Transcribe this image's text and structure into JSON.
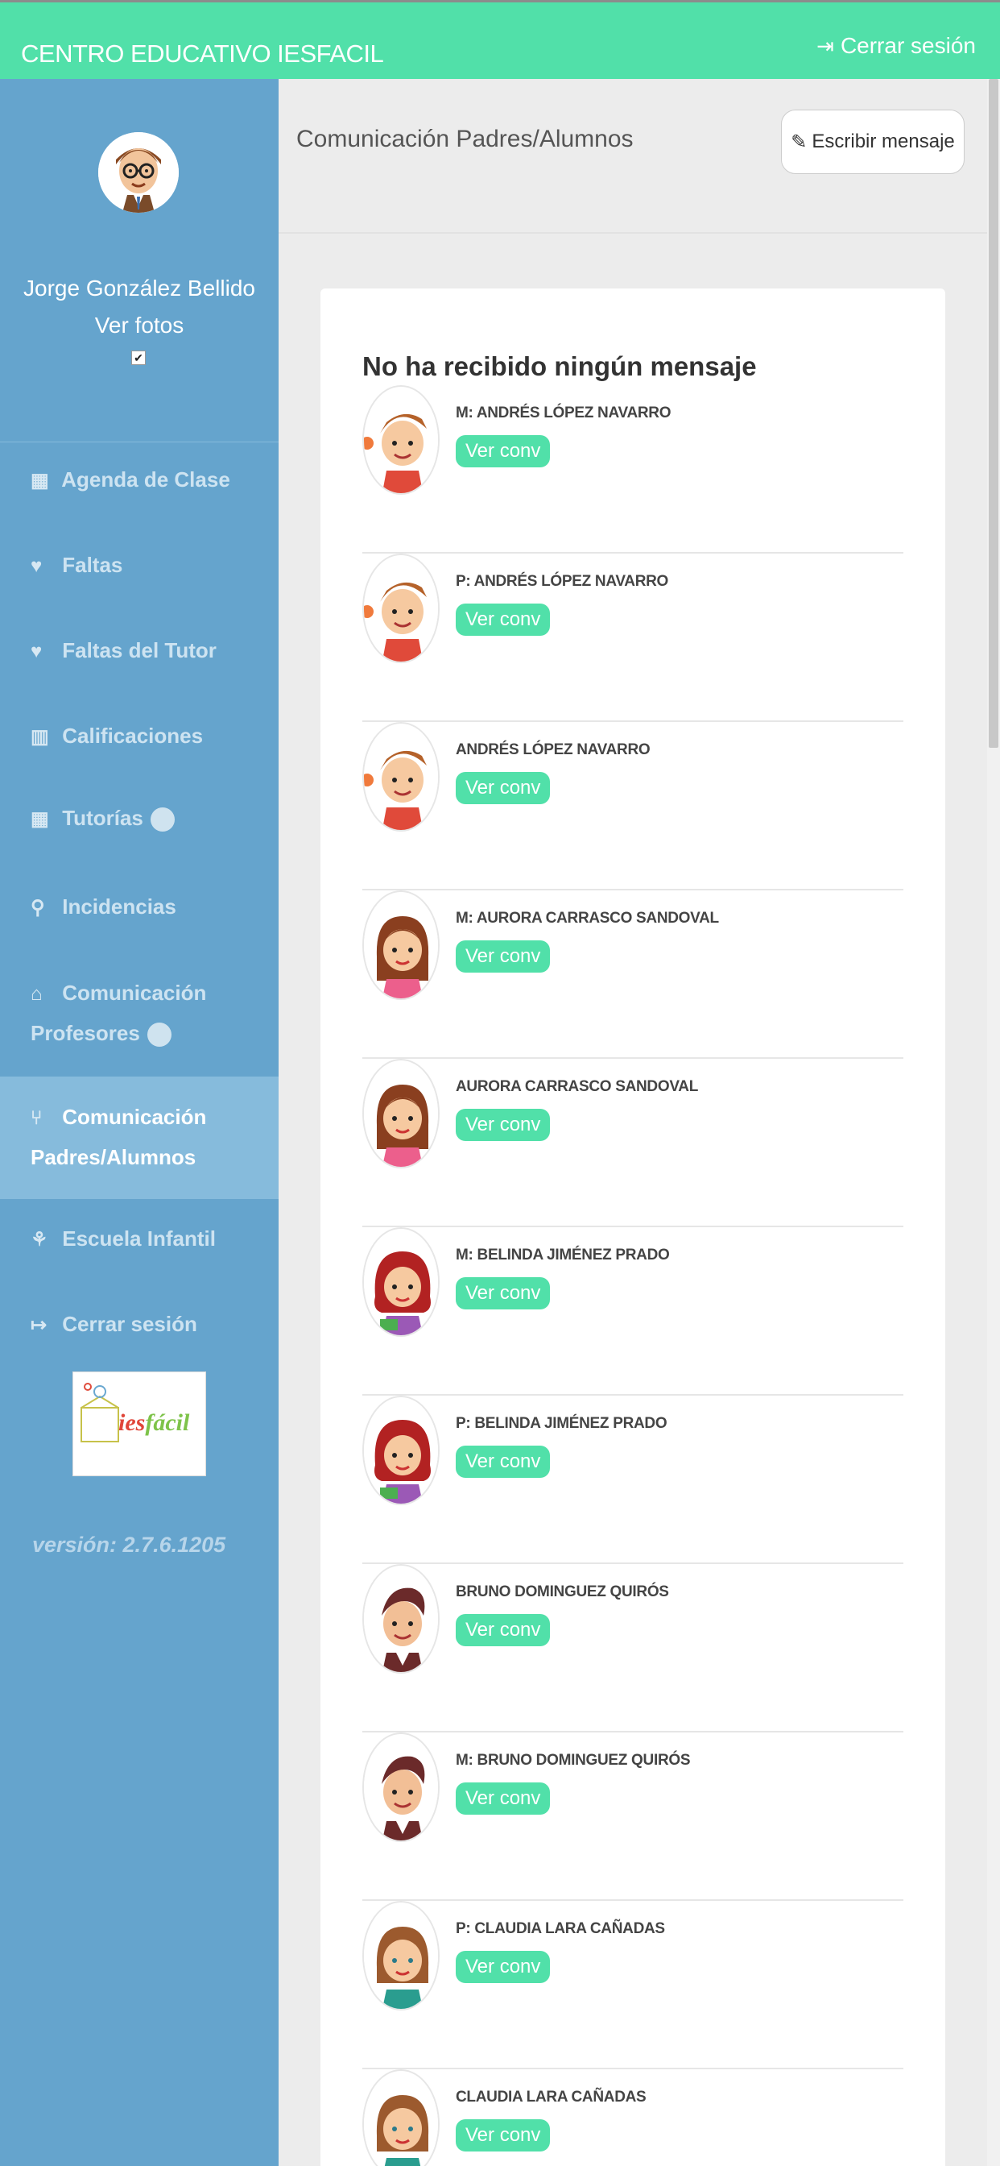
{
  "header": {
    "brand": "CENTRO EDUCATIVO IESFACIL",
    "logout_label": "Cerrar sesión",
    "logout_icon": "sign-out-icon"
  },
  "sidebar": {
    "user_name": "Jorge González Bellido",
    "ver_fotos": "Ver fotos",
    "items": [
      {
        "label": "Agenda de Clase",
        "icon": "calendar-icon",
        "glyph": "▦"
      },
      {
        "label": "Faltas",
        "icon": "heart-icon",
        "glyph": "♥"
      },
      {
        "label": "Faltas del Tutor",
        "icon": "heart-icon",
        "glyph": "♥"
      },
      {
        "label": "Calificaciones",
        "icon": "bar-chart-icon",
        "glyph": "▥"
      },
      {
        "label": "Tutorías",
        "icon": "calendar-icon",
        "glyph": "▦"
      },
      {
        "label": "Incidencias",
        "icon": "pin-icon",
        "glyph": "⚲"
      },
      {
        "label": "Comunicación Profesores",
        "icon": "graduation-cap-icon",
        "glyph": "⌂"
      },
      {
        "label": "Comunicación Padres/Alumnos",
        "icon": "cutlery-icon",
        "glyph": "⑂"
      },
      {
        "label": "Escuela Infantil",
        "icon": "child-icon",
        "glyph": "⚘"
      },
      {
        "label": "Cerrar sesión",
        "icon": "sign-out-icon",
        "glyph": "↦"
      }
    ],
    "logo_text": "iesfácil",
    "version": "versión: 2.7.6.1205"
  },
  "main": {
    "title": "Comunicación Padres/Alumnos",
    "write_button": "Escribir mensaje",
    "write_icon": "pencil-icon",
    "empty_message": "No ha recibido ningún mensaje",
    "conv_label": "Ver conv",
    "messages": [
      {
        "name": "M: ANDRÉS LÓPEZ NAVARRO",
        "avatar": "boy-avatar"
      },
      {
        "name": "P: ANDRÉS LÓPEZ NAVARRO",
        "avatar": "boy-avatar"
      },
      {
        "name": "ANDRÉS LÓPEZ NAVARRO",
        "avatar": "boy-avatar"
      },
      {
        "name": "M: AURORA CARRASCO SANDOVAL",
        "avatar": "girl-avatar"
      },
      {
        "name": "AURORA CARRASCO SANDOVAL",
        "avatar": "girl-avatar"
      },
      {
        "name": "M: BELINDA JIMÉNEZ PRADO",
        "avatar": "girl-redhair-avatar"
      },
      {
        "name": "P: BELINDA JIMÉNEZ PRADO",
        "avatar": "girl-redhair-avatar"
      },
      {
        "name": "BRUNO DOMINGUEZ QUIRÓS",
        "avatar": "boy-darkhair-avatar"
      },
      {
        "name": "M: BRUNO DOMINGUEZ QUIRÓS",
        "avatar": "boy-darkhair-avatar"
      },
      {
        "name": "P: CLAUDIA LARA CAÑADAS",
        "avatar": "girl-avatar"
      },
      {
        "name": "CLAUDIA LARA CAÑADAS",
        "avatar": "girl-avatar"
      }
    ]
  }
}
